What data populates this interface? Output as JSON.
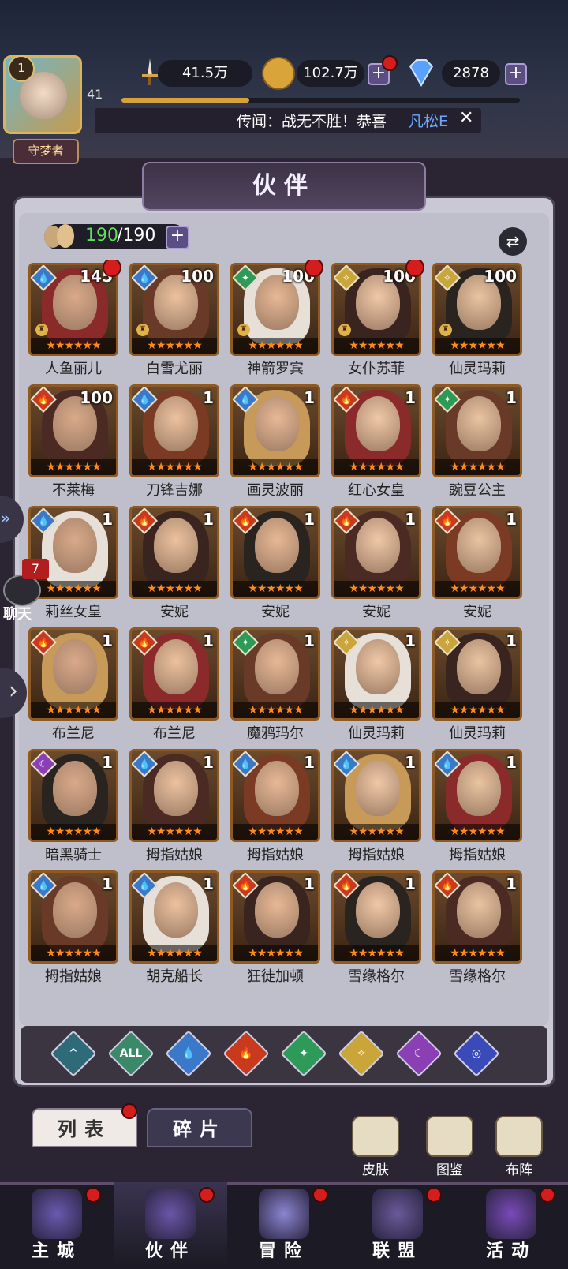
{
  "player": {
    "level": "1",
    "exp_level": "41",
    "title": "守梦者",
    "exp_progress": 0.32
  },
  "resources": {
    "power": "41.5万",
    "gold": "102.7万",
    "diamonds": "2878"
  },
  "news": {
    "text": "传闻：战无不胜！恭喜",
    "highlight": "凡松E"
  },
  "screen_title": "伙伴",
  "partner_count": {
    "current": "190",
    "max": "/190"
  },
  "colors": {
    "water": "#3a78c9",
    "fire": "#c8391e",
    "wind": "#2e9a58",
    "light": "#c9a53a",
    "dark": "#8a3fb5",
    "all": "#3a8a6a"
  },
  "cards": [
    {
      "name": "人鱼丽儿",
      "level": "145",
      "element": "water",
      "stars": 6,
      "dot": true,
      "chess": true
    },
    {
      "name": "白雪尤丽",
      "level": "100",
      "element": "water",
      "stars": 6,
      "dot": false,
      "chess": true
    },
    {
      "name": "神箭罗宾",
      "level": "100",
      "element": "wind",
      "stars": 6,
      "dot": true,
      "chess": true
    },
    {
      "name": "女仆苏菲",
      "level": "100",
      "element": "light",
      "stars": 6,
      "dot": true,
      "chess": true
    },
    {
      "name": "仙灵玛莉",
      "level": "100",
      "element": "light",
      "stars": 6,
      "dot": false,
      "chess": true
    },
    {
      "name": "不莱梅",
      "level": "100",
      "element": "fire",
      "stars": 6,
      "dot": false,
      "chess": false
    },
    {
      "name": "刀锋吉娜",
      "level": "1",
      "element": "water",
      "stars": 6,
      "dot": false,
      "chess": false
    },
    {
      "name": "画灵波丽",
      "level": "1",
      "element": "water",
      "stars": 6,
      "dot": false,
      "chess": false
    },
    {
      "name": "红心女皇",
      "level": "1",
      "element": "fire",
      "stars": 6,
      "dot": false,
      "chess": false
    },
    {
      "name": "豌豆公主",
      "level": "1",
      "element": "wind",
      "stars": 6,
      "dot": false,
      "chess": false
    },
    {
      "name": "莉丝女皇",
      "level": "1",
      "element": "water",
      "stars": 6,
      "dot": false,
      "chess": false
    },
    {
      "name": "安妮",
      "level": "1",
      "element": "fire",
      "stars": 6,
      "dot": false,
      "chess": false
    },
    {
      "name": "安妮",
      "level": "1",
      "element": "fire",
      "stars": 6,
      "dot": false,
      "chess": false
    },
    {
      "name": "安妮",
      "level": "1",
      "element": "fire",
      "stars": 6,
      "dot": false,
      "chess": false
    },
    {
      "name": "安妮",
      "level": "1",
      "element": "fire",
      "stars": 6,
      "dot": false,
      "chess": false
    },
    {
      "name": "布兰尼",
      "level": "1",
      "element": "fire",
      "stars": 6,
      "dot": false,
      "chess": false
    },
    {
      "name": "布兰尼",
      "level": "1",
      "element": "fire",
      "stars": 6,
      "dot": false,
      "chess": false
    },
    {
      "name": "魔鸦玛尔",
      "level": "1",
      "element": "wind",
      "stars": 6,
      "dot": false,
      "chess": false
    },
    {
      "name": "仙灵玛莉",
      "level": "1",
      "element": "light",
      "stars": 6,
      "dot": false,
      "chess": false
    },
    {
      "name": "仙灵玛莉",
      "level": "1",
      "element": "light",
      "stars": 6,
      "dot": false,
      "chess": false
    },
    {
      "name": "暗黑骑士",
      "level": "1",
      "element": "dark",
      "stars": 6,
      "dot": false,
      "chess": false
    },
    {
      "name": "拇指姑娘",
      "level": "1",
      "element": "water",
      "stars": 6,
      "dot": false,
      "chess": false
    },
    {
      "name": "拇指姑娘",
      "level": "1",
      "element": "water",
      "stars": 6,
      "dot": false,
      "chess": false
    },
    {
      "name": "拇指姑娘",
      "level": "1",
      "element": "water",
      "stars": 6,
      "dot": false,
      "chess": false
    },
    {
      "name": "拇指姑娘",
      "level": "1",
      "element": "water",
      "stars": 6,
      "dot": false,
      "chess": false
    },
    {
      "name": "拇指姑娘",
      "level": "1",
      "element": "water",
      "stars": 6,
      "dot": false,
      "chess": false
    },
    {
      "name": "胡克船长",
      "level": "1",
      "element": "water",
      "stars": 6,
      "dot": false,
      "chess": false
    },
    {
      "name": "狂徒加顿",
      "level": "1",
      "element": "fire",
      "stars": 6,
      "dot": false,
      "chess": false
    },
    {
      "name": "雪缘格尔",
      "level": "1",
      "element": "fire",
      "stars": 6,
      "dot": false,
      "chess": false
    },
    {
      "name": "雪缘格尔",
      "level": "1",
      "element": "fire",
      "stars": 6,
      "dot": false,
      "chess": false
    }
  ],
  "filters": [
    {
      "icon": "all-element-icon",
      "label": "",
      "element": "neutral"
    },
    {
      "icon": "all-icon",
      "label": "ALL",
      "element": "all"
    },
    {
      "icon": "water-icon",
      "label": "",
      "element": "water"
    },
    {
      "icon": "fire-icon",
      "label": "",
      "element": "fire"
    },
    {
      "icon": "wind-icon",
      "label": "",
      "element": "wind"
    },
    {
      "icon": "light-icon",
      "label": "",
      "element": "light"
    },
    {
      "icon": "dark-icon",
      "label": "",
      "element": "dark"
    },
    {
      "icon": "planet-icon",
      "label": "",
      "element": "cosmic"
    }
  ],
  "tabs": {
    "list": "列表",
    "fragments": "碎片"
  },
  "side_buttons": {
    "skin": "皮肤",
    "codex": "图鉴",
    "formation": "布阵"
  },
  "chat": {
    "badge": "7",
    "label": "聊天"
  },
  "nav": [
    {
      "label": "主城",
      "icon": "castle-icon"
    },
    {
      "label": "伙伴",
      "icon": "witch-hat-icon"
    },
    {
      "label": "冒险",
      "icon": "portal-icon"
    },
    {
      "label": "联盟",
      "icon": "shield-icon"
    },
    {
      "label": "活动",
      "icon": "cards-icon"
    }
  ]
}
